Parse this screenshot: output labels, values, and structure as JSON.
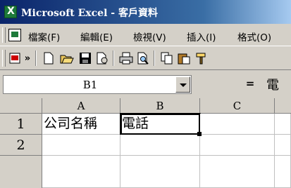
{
  "window": {
    "title": "Microsoft Excel - 客戶資料"
  },
  "menu": [
    "檔案(F)",
    "編輯(E)",
    "檢視(V)",
    "插入(I)",
    "格式(O)"
  ],
  "toolbar": {
    "icons": [
      "add-in-icon",
      "more-chevron-icon",
      "new-icon",
      "open-icon",
      "save-icon",
      "permission-icon",
      "print-icon",
      "print-preview-icon",
      "copy-icon",
      "paste-icon",
      "format-painter-icon"
    ]
  },
  "formula_bar": {
    "name_box": "B1",
    "equals": "=",
    "content": "電"
  },
  "sheet": {
    "columns": [
      "A",
      "B",
      "C"
    ],
    "rows": [
      "1",
      "2"
    ],
    "cells": {
      "A1": "公司名稱",
      "B1": "電話",
      "C1": "",
      "A2": "",
      "B2": "",
      "C2": ""
    }
  }
}
